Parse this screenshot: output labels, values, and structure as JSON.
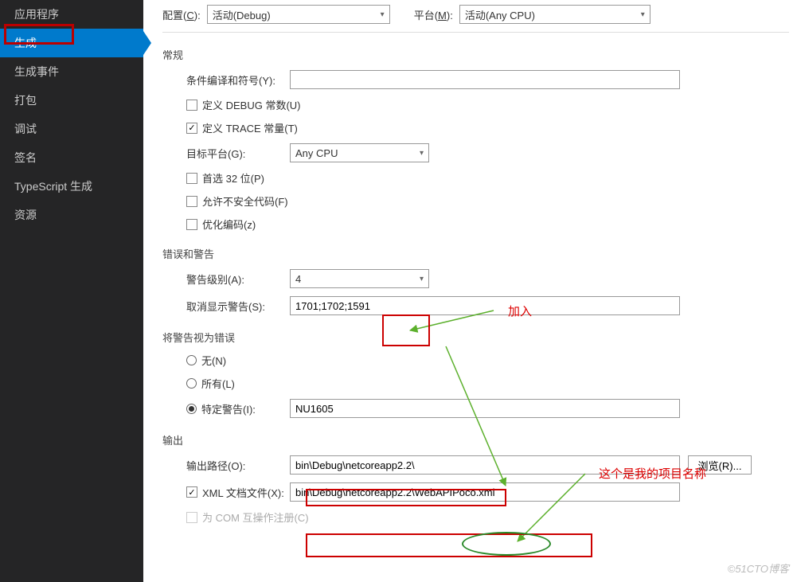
{
  "sidebar": {
    "items": [
      {
        "label": "应用程序"
      },
      {
        "label": "生成"
      },
      {
        "label": "生成事件"
      },
      {
        "label": "打包"
      },
      {
        "label": "调试"
      },
      {
        "label": "签名"
      },
      {
        "label": "TypeScript 生成"
      },
      {
        "label": "资源"
      }
    ],
    "selected_index": 1
  },
  "top": {
    "config_label_prefix": "配置(",
    "config_label_u": "C",
    "config_label_suffix": "):",
    "config_value": "活动(Debug)",
    "platform_label_prefix": "平台(",
    "platform_label_u": "M",
    "platform_label_suffix": "):",
    "platform_value": "活动(Any CPU)"
  },
  "general": {
    "title": "常规",
    "cond_symbols_label": "条件编译和符号(Y):",
    "cond_symbols_value": "",
    "debug_const_label": "定义 DEBUG 常数(U)",
    "debug_const_checked": false,
    "trace_const_label": "定义 TRACE 常量(T)",
    "trace_const_checked": true,
    "target_platform_label": "目标平台(G):",
    "target_platform_value": "Any CPU",
    "prefer32_label": "首选 32 位(P)",
    "prefer32_checked": false,
    "unsafe_label": "允许不安全代码(F)",
    "unsafe_checked": false,
    "optimize_label": "优化编码(z)",
    "optimize_checked": false
  },
  "warnings": {
    "title": "错误和警告",
    "level_label": "警告级别(A):",
    "level_value": "4",
    "suppress_label": "取消显示警告(S):",
    "suppress_value": "1701;1702;1591"
  },
  "treat_as_error": {
    "title": "将警告视为错误",
    "none_label": "无(N)",
    "all_label": "所有(L)",
    "specific_label": "特定警告(I):",
    "specific_value": "NU1605",
    "selected": "specific"
  },
  "output": {
    "title": "输出",
    "path_label": "输出路径(O):",
    "path_value": "bin\\Debug\\netcoreapp2.2\\",
    "browse_label": "浏览(R)...",
    "xml_label": "XML 文档文件(X):",
    "xml_checked": true,
    "xml_value": "bin\\Debug\\netcoreapp2.2\\WebAPIPoco.xml",
    "com_label": "为 COM 互操作注册(C)",
    "com_checked": false
  },
  "annotations": {
    "add_text": "加入",
    "project_name_text": "这个是我的项目名称"
  },
  "watermark": "©51CTO博客"
}
